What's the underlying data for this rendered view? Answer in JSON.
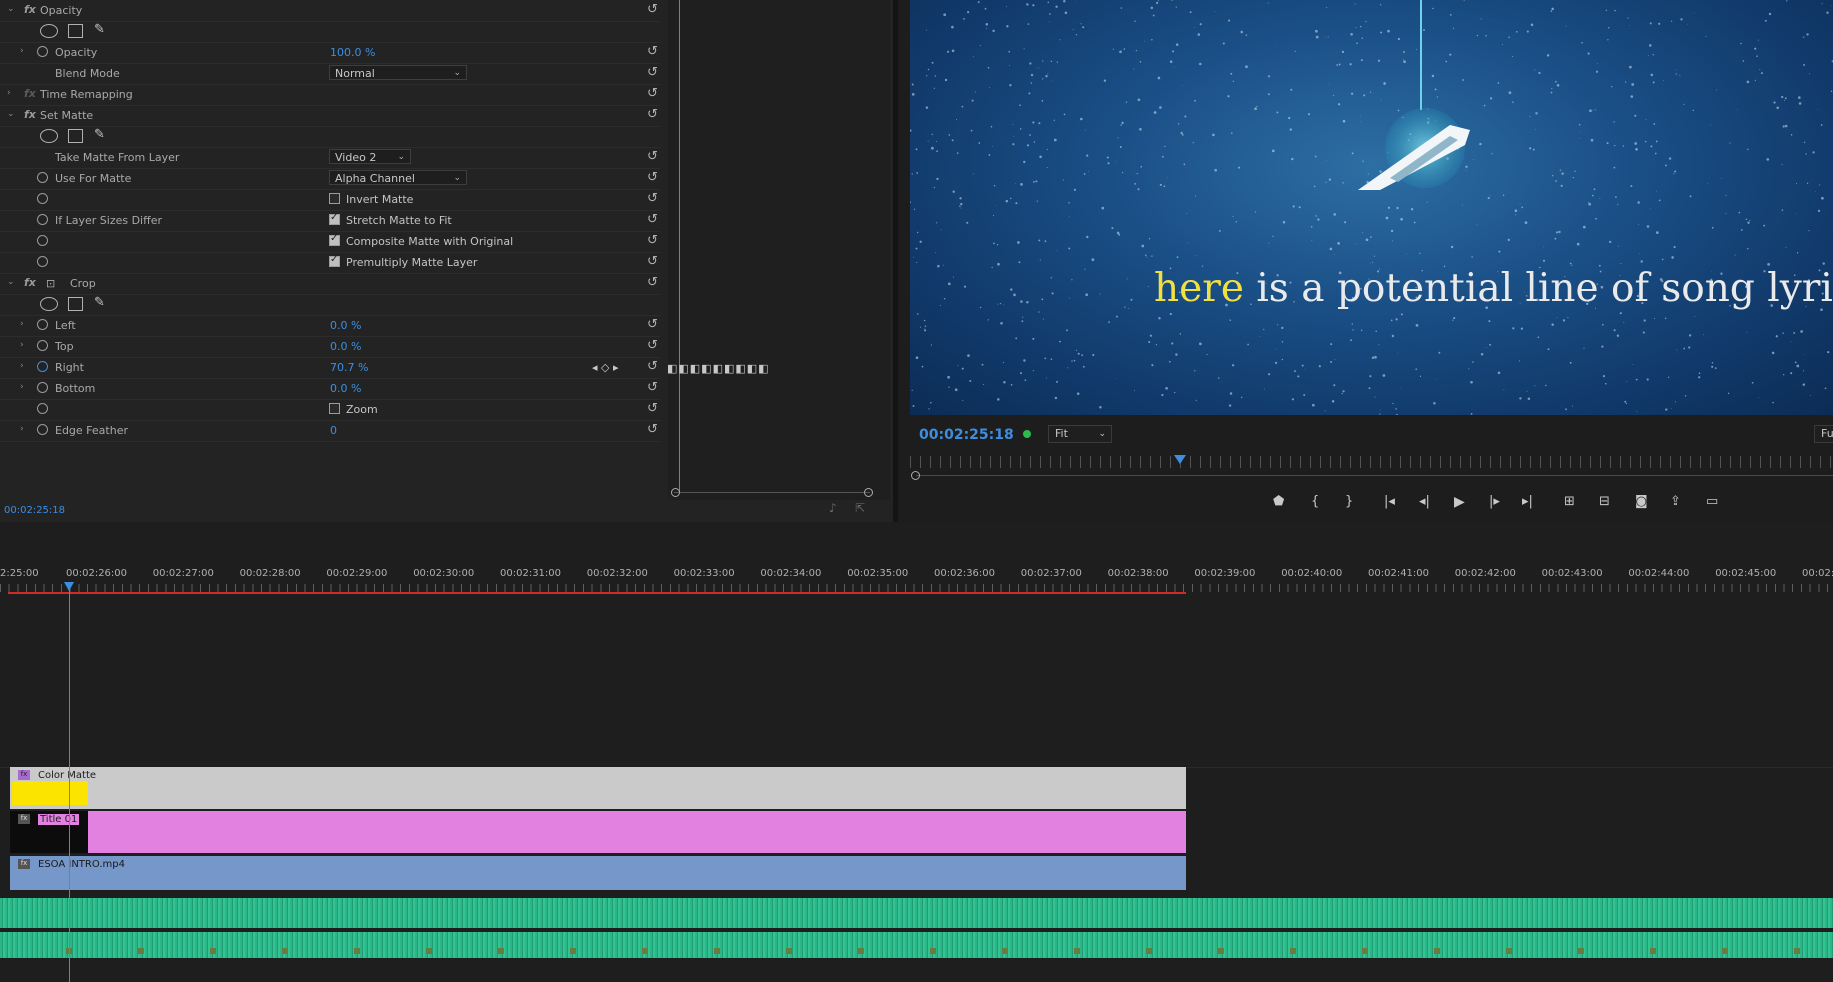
{
  "effect_controls": {
    "current_time": "00:02:25:18",
    "rows": [
      {
        "type": "section",
        "twirl": "open",
        "fx": true,
        "label": "Opacity"
      },
      {
        "type": "masks"
      },
      {
        "type": "param",
        "twirl": true,
        "stopwatch": true,
        "label": "Opacity",
        "value": "100.0 %"
      },
      {
        "type": "param",
        "label": "Blend Mode",
        "dropdown": "Normal"
      },
      {
        "type": "section",
        "twirl": "closed",
        "fx": true,
        "dim": true,
        "label": "Time Remapping"
      },
      {
        "type": "section",
        "twirl": "open",
        "fx": true,
        "label": "Set Matte"
      },
      {
        "type": "masks"
      },
      {
        "type": "param",
        "label": "Take Matte From Layer",
        "dropdown": "Video 2"
      },
      {
        "type": "param",
        "stopwatch": true,
        "label": "Use For Matte",
        "dropdown": "Alpha Channel"
      },
      {
        "type": "param",
        "stopwatch": true,
        "label": "",
        "checkbox": false,
        "check_label": "Invert Matte"
      },
      {
        "type": "param",
        "stopwatch": true,
        "label": "If Layer Sizes Differ",
        "checkbox": true,
        "check_label": "Stretch Matte to Fit"
      },
      {
        "type": "param",
        "stopwatch": true,
        "label": "",
        "checkbox": true,
        "check_label": "Composite Matte with Original"
      },
      {
        "type": "param",
        "stopwatch": true,
        "label": "",
        "checkbox": true,
        "check_label": "Premultiply Matte Layer"
      },
      {
        "type": "section",
        "twirl": "open",
        "fx": true,
        "label": "Crop",
        "crop_icon": true
      },
      {
        "type": "masks"
      },
      {
        "type": "param",
        "twirl": true,
        "stopwatch": true,
        "label": "Left",
        "value": "0.0 %"
      },
      {
        "type": "param",
        "twirl": true,
        "stopwatch": true,
        "label": "Top",
        "value": "0.0 %"
      },
      {
        "type": "param",
        "twirl": true,
        "stopwatch": true,
        "active": true,
        "label": "Right",
        "value": "70.7 %",
        "keyframe_nav": true
      },
      {
        "type": "param",
        "twirl": true,
        "stopwatch": true,
        "label": "Bottom",
        "value": "0.0 %"
      },
      {
        "type": "param",
        "stopwatch": true,
        "label": "",
        "checkbox": false,
        "check_label": "Zoom"
      },
      {
        "type": "param",
        "twirl": true,
        "stopwatch": true,
        "label": "Edge Feather",
        "value": "0"
      }
    ]
  },
  "program_monitor": {
    "overlay_highlight": "here",
    "overlay_rest": " is a potential line of song lyrics",
    "timecode": "00:02:25:18",
    "fit_label": "Fit",
    "full_label": "Fu",
    "highlight_color": "#f0e040"
  },
  "timeline": {
    "ruler_labels": [
      "2:25:00",
      "00:02:26:00",
      "00:02:27:00",
      "00:02:28:00",
      "00:02:29:00",
      "00:02:30:00",
      "00:02:31:00",
      "00:02:32:00",
      "00:02:33:00",
      "00:02:34:00",
      "00:02:35:00",
      "00:02:36:00",
      "00:02:37:00",
      "00:02:38:00",
      "00:02:39:00",
      "00:02:40:00",
      "00:02:41:00",
      "00:02:42:00",
      "00:02:43:00",
      "00:02:44:00",
      "00:02:45:00",
      "00:02:"
    ],
    "clips": {
      "color_matte": "Color Matte",
      "title": "Title 01",
      "video": "ESOA INTRO.mp4"
    },
    "colors": {
      "color_matte": "#cacaca",
      "title": "#e381e0",
      "video": "#7597c9",
      "audio": "#2bb588",
      "playhead": "#3d8ee0",
      "work_area": "#d12b2b"
    }
  },
  "icons": [
    "stopwatch-icon",
    "reset-icon",
    "ellipse-mask-icon",
    "rect-mask-icon",
    "pen-mask-icon",
    "twirl-icon",
    "crop-icon",
    "marker-icon",
    "mark-in-icon",
    "mark-out-icon",
    "go-to-in-icon",
    "step-back-icon",
    "play-icon",
    "step-forward-icon",
    "go-to-out-icon",
    "lift-icon",
    "extract-icon",
    "camera-icon",
    "export-icon",
    "compare-icon"
  ]
}
